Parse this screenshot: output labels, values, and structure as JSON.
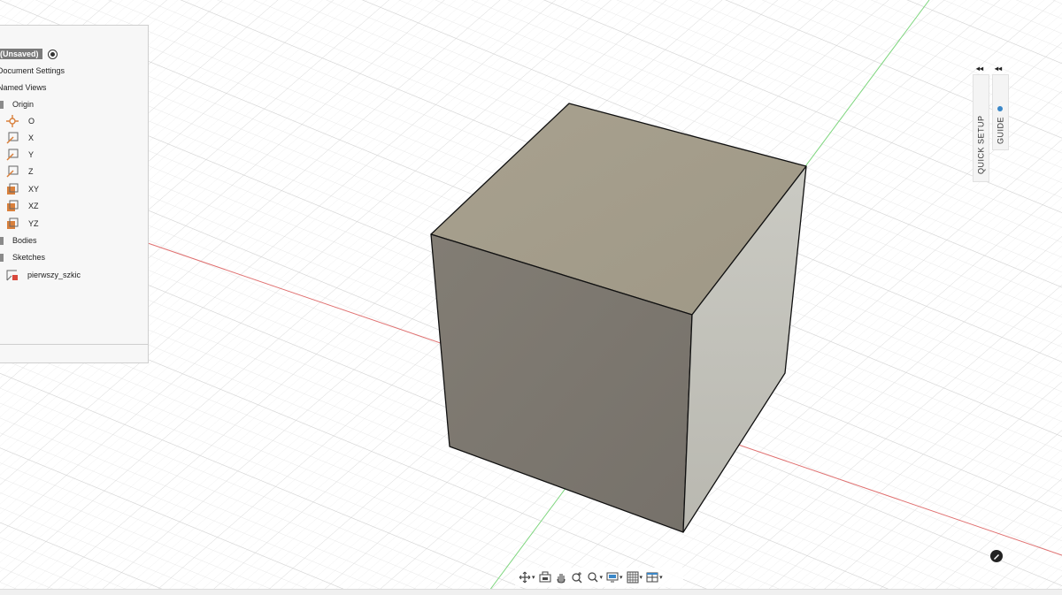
{
  "browser": {
    "root_label": "(Unsaved)",
    "items": {
      "document_settings": "Document Settings",
      "named_views": "Named Views",
      "origin": "Origin",
      "origin_point": "O",
      "axis_x": "X",
      "axis_y": "Y",
      "axis_z": "Z",
      "plane_xy": "XY",
      "plane_xz": "XZ",
      "plane_yz": "YZ",
      "bodies": "Bodies",
      "sketches": "Sketches",
      "sketch_1": "pierwszy_szkic"
    }
  },
  "side_panels": {
    "quick_setup": "QUICK SETUP",
    "guide": "GUIDE",
    "collapse_glyph": "◂◂"
  },
  "colors": {
    "accent": "#3a87c8",
    "origin_orange": "#d9803c",
    "x_axis": "#e07070",
    "y_axis": "#7ed67e",
    "cube_top": "#a59e8e",
    "cube_front": "#7b766d",
    "cube_right": "#c3c2bb"
  },
  "nav_icons": [
    "orbit-icon",
    "look-at-icon",
    "pan-icon",
    "zoom-icon",
    "fit-icon",
    "display-settings-icon",
    "grid-icon",
    "viewports-icon"
  ]
}
